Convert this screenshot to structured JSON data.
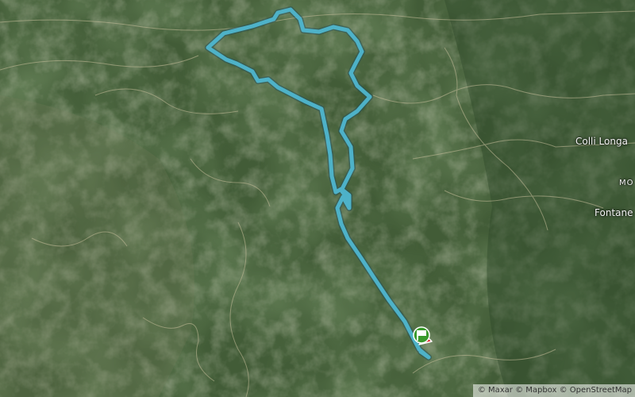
{
  "map": {
    "labels": {
      "colli_longa": "Colli Longa",
      "mo": "MO",
      "fontane": "Fontane"
    },
    "markers": {
      "start": "start-flag",
      "end": "end-pin"
    },
    "colors": {
      "route": "#4fb6cf",
      "start": "#3a9a2c",
      "end": "#e0222a"
    }
  },
  "attribution": "© Maxar © Mapbox © OpenStreetMap"
}
